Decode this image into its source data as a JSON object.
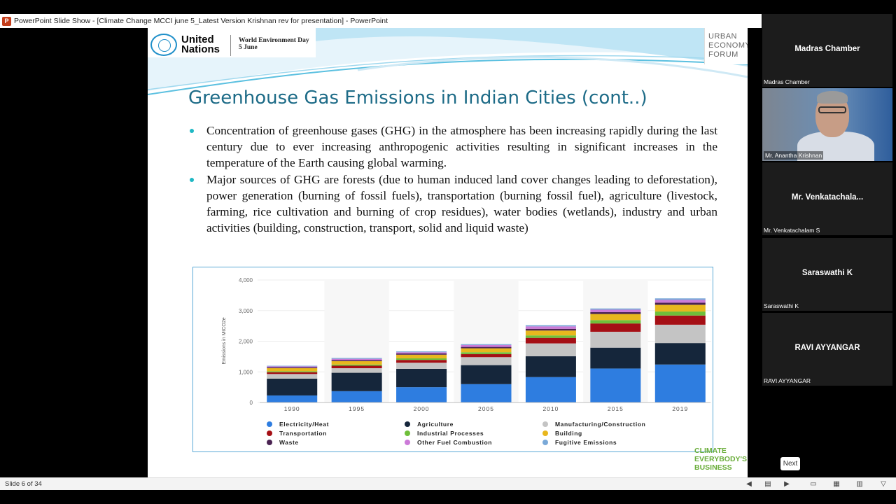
{
  "window": {
    "title": "PowerPoint Slide Show - [Climate Change MCCI  june 5_Latest Version Krishnan rev for presentation] - PowerPoint",
    "app_icon": "powerpoint-icon"
  },
  "slide": {
    "un_logo_line1": "United",
    "un_logo_line2": "Nations",
    "event_line1": "World Environment Day",
    "event_line2": "5 June",
    "uef_line1": "URBAN",
    "uef_line2": "ECONOMY",
    "uef_line3": "FORUM",
    "title": "Greenhouse Gas Emissions in Indian Cities (cont..)",
    "bullets": [
      "Concentration of greenhouse gases (GHG) in the atmosphere has been increasing rapidly during the last century due to ever increasing anthropogenic activities resulting in significant increases in the temperature of the Earth causing global warming.",
      "Major sources of GHG are forests (due to human induced land cover changes leading to deforestation), power generation (burning of fossil fuels), transportation (burning fossil fuel), agriculture (livestock, farming, rice cultivation and burning of crop residues), water bodies (wetlands), industry and urban activities (building, construction, transport, solid and liquid waste)"
    ],
    "footer_logo_line1": "CLIMATE",
    "footer_logo_line2": "EVERYBODY'S",
    "footer_logo_line3": "BUSINESS"
  },
  "chart_data": {
    "type": "bar",
    "stacked": true,
    "categories": [
      "1990",
      "1995",
      "2000",
      "2005",
      "2010",
      "2015",
      "2019"
    ],
    "ylabel": "Emissions in MtCO2e",
    "ylim": [
      0,
      4000
    ],
    "yticks": [
      "0",
      "1,000",
      "2,000",
      "3,000",
      "4,000"
    ],
    "legend_position": "bottom",
    "series": [
      {
        "name": "Electricity/Heat",
        "color": "#2e7de0",
        "values": [
          230,
          370,
          500,
          600,
          830,
          1110,
          1240
        ]
      },
      {
        "name": "Agriculture",
        "color": "#15263b",
        "values": [
          550,
          600,
          600,
          620,
          680,
          680,
          700
        ]
      },
      {
        "name": "Manufacturing/Construction",
        "color": "#c4c4c4",
        "values": [
          150,
          150,
          200,
          260,
          420,
          520,
          600
        ]
      },
      {
        "name": "Transportation",
        "color": "#a50f15",
        "values": [
          60,
          80,
          90,
          100,
          180,
          270,
          300
        ]
      },
      {
        "name": "Industrial Processes",
        "color": "#6fbf3a",
        "values": [
          30,
          40,
          50,
          60,
          80,
          110,
          130
        ]
      },
      {
        "name": "Building",
        "color": "#e8b71e",
        "values": [
          100,
          110,
          120,
          130,
          160,
          200,
          220
        ]
      },
      {
        "name": "Waste",
        "color": "#4a2352",
        "values": [
          30,
          35,
          40,
          45,
          55,
          60,
          70
        ]
      },
      {
        "name": "Other Fuel Combustion",
        "color": "#cc7ad8",
        "values": [
          30,
          40,
          40,
          60,
          80,
          80,
          90
        ]
      },
      {
        "name": "Fugitive Emissions",
        "color": "#7aa9d8",
        "values": [
          20,
          30,
          30,
          30,
          40,
          40,
          50
        ]
      }
    ]
  },
  "participants": [
    {
      "display": "Madras Chamber",
      "label": "Madras Chamber",
      "video": false
    },
    {
      "display": "",
      "label": "Mr. Anantha Krishnan",
      "video": true
    },
    {
      "display": "Mr.  Venkatachala...",
      "label": "Mr. Venkatachalam S",
      "video": false
    },
    {
      "display": "Saraswathi K",
      "label": "Saraswathi K",
      "video": false
    },
    {
      "display": "RAVI AYYANGAR",
      "label": "RAVI AYYANGAR",
      "video": false
    }
  ],
  "next_button": "Next",
  "statusbar": {
    "slide_count": "Slide 6 of 34"
  }
}
